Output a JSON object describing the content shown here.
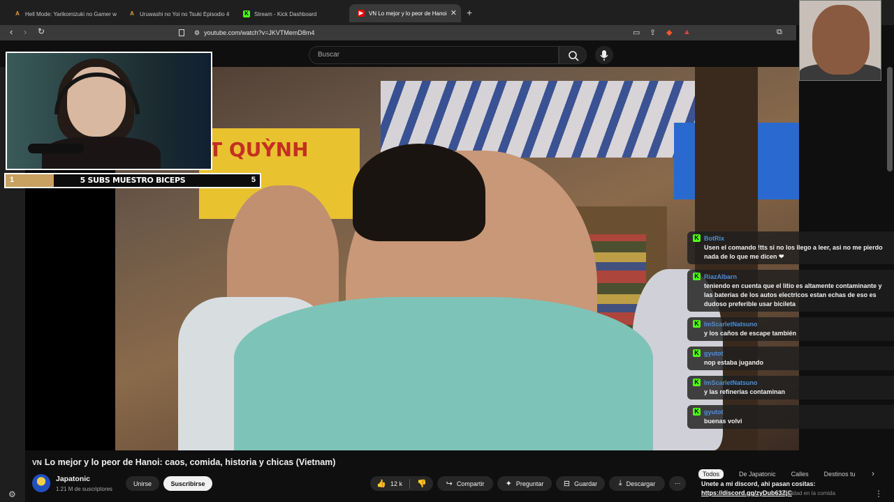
{
  "browser": {
    "tabs": [
      {
        "title": "Hell Mode: Yarikomizuki no Gamer w",
        "icon": "af-icon"
      },
      {
        "title": "Uruwashi no Yoi no Tsuki Episodio 4",
        "icon": "af-icon"
      },
      {
        "title": "Stream - Kick Dashboard",
        "icon": "kick-icon"
      },
      {
        "title": "Lo mejor y lo peor de Hanoi",
        "icon": "youtube-icon"
      }
    ],
    "active_tab_prefix": "VN",
    "new_tab": "+",
    "url": "youtube.com/watch?v=JKVTMemD8m4"
  },
  "youtube": {
    "search_placeholder": "Buscar"
  },
  "overlay": {
    "goal_start": "1",
    "goal_label": "5 SUBS MUESTRO BICEPS",
    "goal_end": "5",
    "goal_progress": 0.19
  },
  "video_sign_text": "T QUỲNH",
  "video": {
    "flag": "VN",
    "title": "Lo mejor y lo peor de Hanoi: caos, comida, historia y chicas (Vietnam)",
    "channel": "Japatonic",
    "subscribers": "1.21 M de suscriptores",
    "join": "Unirse",
    "subscribe": "Suscribirse",
    "likes": "12 k",
    "share": "Compartir",
    "ask": "Preguntar",
    "save": "Guardar",
    "download": "Descargar"
  },
  "chat": [
    {
      "user": "BotRix",
      "text": "Usen el comando !tts si no los llego a leer, asi no me pierdo nada de lo que me dicen ❤"
    },
    {
      "user": "RiazAlbarn",
      "text": "teniendo en cuenta que el litio es altamente contaminante y las baterias de los autos electricos estan echas de eso es dudoso preferible usar bicileta"
    },
    {
      "user": "ImScarletNatsuno",
      "text": "y los caños de escape también"
    },
    {
      "user": "gyutot",
      "text": "nop estaba jugando"
    },
    {
      "user": "ImScarletNatsuno",
      "text": "y las refinerias contaminan"
    },
    {
      "user": "gyutot",
      "text": "buenas volvi"
    }
  ],
  "related_tabs": [
    "Todos",
    "De Japatonic",
    "Calles",
    "Destinos tu"
  ],
  "pinned": {
    "text": "Unete a mi discord, ahi pasan cositas:",
    "link": "https://discord.gg/zyDub63ZjC",
    "ghost": "realidad en la comida"
  },
  "colors": {
    "kick_green": "#53fc18",
    "chat_user": "#4a90d8",
    "goal_fill": "#c8a060"
  }
}
